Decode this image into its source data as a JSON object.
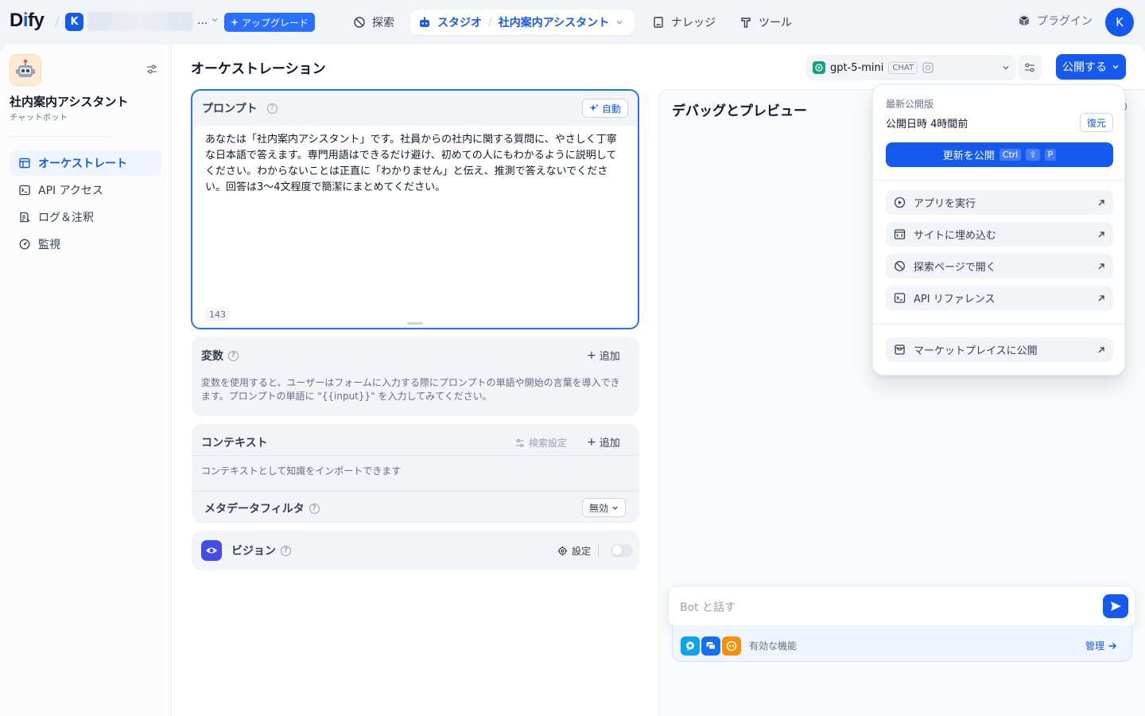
{
  "brand": {
    "logo_text_d": "D",
    "logo_text_i": "i",
    "logo_text_rest": "fy"
  },
  "workspace": {
    "initial": "K",
    "ellipsis": "..."
  },
  "header": {
    "upgrade_label": "アップグレード",
    "nav": {
      "explore": "探索",
      "studio": "スタジオ",
      "app_breadcrumb": "社内案内アシスタント",
      "knowledge": "ナレッジ",
      "tools": "ツール"
    },
    "plugin_label": "プラグイン",
    "avatar_initial": "K"
  },
  "sidebar": {
    "app_name": "社内案内アシスタント",
    "app_type": "チャットボット",
    "items": [
      {
        "label": "オーケストレート"
      },
      {
        "label": "API アクセス"
      },
      {
        "label": "ログ＆注釈"
      },
      {
        "label": "監視"
      }
    ]
  },
  "orchestration": {
    "title": "オーケストレーション",
    "model_name": "gpt-5-mini",
    "model_mode": "CHAT",
    "publish_label": "公開する",
    "prompt": {
      "label": "プロンプト",
      "auto_label": "自動",
      "text": "あなたは「社内案内アシスタント」です。社員からの社内に関する質問に、やさしく丁寧な日本語で答えます。専門用語はできるだけ避け、初めての人にもわかるように説明してください。わからないことは正直に「わかりません」と伝え、推測で答えないでください。回答は3〜4文程度で簡潔にまとめてください。",
      "char_count": "143"
    },
    "variables": {
      "title": "変数",
      "add_label": "追加",
      "desc": "変数を使用すると、ユーザーはフォームに入力する際にプロンプトの単語や開始の言葉を導入できます。プロンプトの単語に \"{{input}}\" を入力してみてください。"
    },
    "context": {
      "title": "コンテキスト",
      "retrieval_label": "検索設定",
      "add_label": "追加",
      "desc": "コンテキストとして知識をインポートできます",
      "metadata_label": "メタデータフィルタ",
      "metadata_value": "無効"
    },
    "vision": {
      "title": "ビジョン",
      "settings_label": "設定",
      "enabled": false
    }
  },
  "debug": {
    "title": "デバッグとプレビュー",
    "chat_placeholder": "Bot と話す",
    "features_label": "有効な機能",
    "manage_label": "管理"
  },
  "publish_dropdown": {
    "latest_label": "最新公開版",
    "published_time": "公開日時 4時間前",
    "restore_label": "復元",
    "update_label": "更新を公開",
    "shortcut": [
      "Ctrl",
      "⇧",
      "P"
    ],
    "items": [
      {
        "label": "アプリを実行",
        "icon": "play-circle-icon"
      },
      {
        "label": "サイトに埋め込む",
        "icon": "embed-icon"
      },
      {
        "label": "探索ページで開く",
        "icon": "explore-icon"
      },
      {
        "label": "API リファレンス",
        "icon": "terminal-icon"
      },
      {
        "label": "マーケットプレイスに公開",
        "icon": "store-icon"
      }
    ]
  },
  "colors": {
    "accent": "#155aef",
    "accent_soft": "#eff4ff",
    "vision_icon": "#444ce7"
  }
}
